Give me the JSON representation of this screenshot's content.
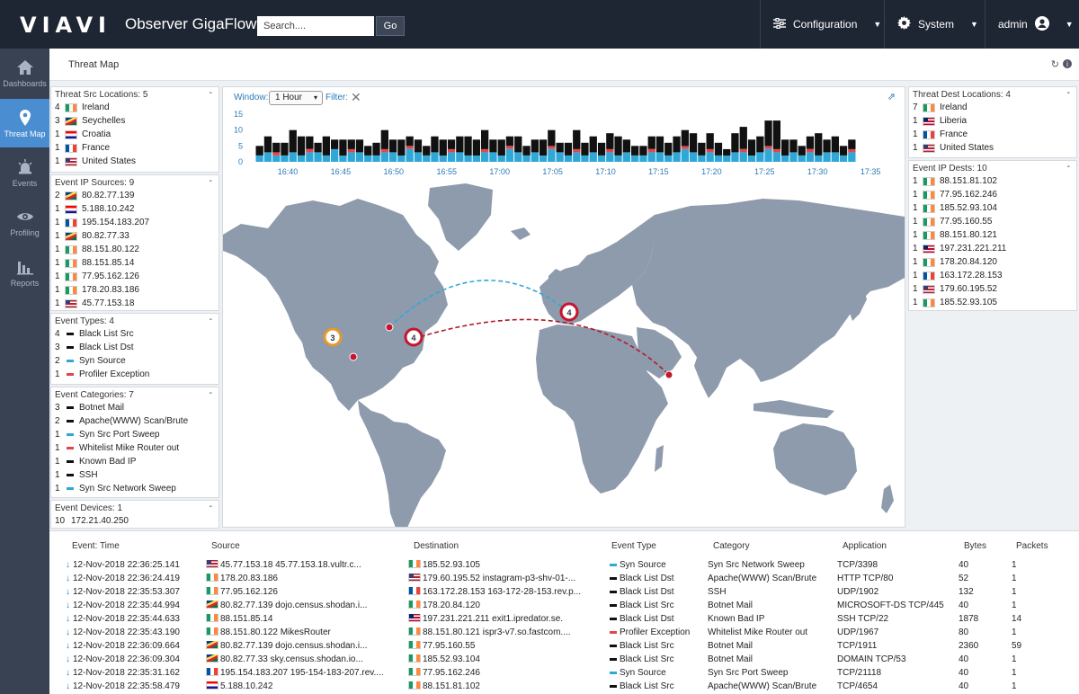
{
  "header": {
    "logo": "VIAVI",
    "app_title": "Observer GigaFlow",
    "search_placeholder": "Search....",
    "go_label": "Go",
    "config_label": "Configuration",
    "system_label": "System",
    "user_label": "admin"
  },
  "sidebar": {
    "items": [
      {
        "label": "Dashboards",
        "icon": "home-icon"
      },
      {
        "label": "Threat Map",
        "icon": "map-pin-icon"
      },
      {
        "label": "Events",
        "icon": "alarm-icon"
      },
      {
        "label": "Profiling",
        "icon": "eye-icon"
      },
      {
        "label": "Reports",
        "icon": "bar-chart-icon"
      }
    ]
  },
  "page": {
    "title": "Threat Map"
  },
  "panels": {
    "src_locations": {
      "title": "Threat Src Locations: 5",
      "rows": [
        {
          "count": "4",
          "label": "Ireland",
          "flag": "ie"
        },
        {
          "count": "3",
          "label": "Seychelles",
          "flag": "sc"
        },
        {
          "count": "1",
          "label": "Croatia",
          "flag": "hr"
        },
        {
          "count": "1",
          "label": "France",
          "flag": "fr"
        },
        {
          "count": "1",
          "label": "United States",
          "flag": "us"
        }
      ]
    },
    "ip_sources": {
      "title": "Event IP Sources: 9",
      "rows": [
        {
          "count": "2",
          "label": "80.82.77.139",
          "flag": "sc"
        },
        {
          "count": "1",
          "label": "5.188.10.242",
          "flag": "hr"
        },
        {
          "count": "1",
          "label": "195.154.183.207",
          "flag": "fr"
        },
        {
          "count": "1",
          "label": "80.82.77.33",
          "flag": "sc"
        },
        {
          "count": "1",
          "label": "88.151.80.122",
          "flag": "ie"
        },
        {
          "count": "1",
          "label": "88.151.85.14",
          "flag": "ie"
        },
        {
          "count": "1",
          "label": "77.95.162.126",
          "flag": "ie"
        },
        {
          "count": "1",
          "label": "178.20.83.186",
          "flag": "ie"
        },
        {
          "count": "1",
          "label": "45.77.153.18",
          "flag": "us"
        }
      ]
    },
    "event_types": {
      "title": "Event Types: 4",
      "rows": [
        {
          "count": "4",
          "label": "Black List Src",
          "color": "#111111"
        },
        {
          "count": "3",
          "label": "Black List Dst",
          "color": "#111111"
        },
        {
          "count": "2",
          "label": "Syn Source",
          "color": "#2fa8d8"
        },
        {
          "count": "1",
          "label": "Profiler Exception",
          "color": "#e0474c"
        }
      ]
    },
    "event_categories": {
      "title": "Event Categories: 7",
      "rows": [
        {
          "count": "3",
          "label": "Botnet Mail",
          "color": "#111111"
        },
        {
          "count": "2",
          "label": "Apache(WWW) Scan/Brute",
          "color": "#111111"
        },
        {
          "count": "1",
          "label": "Syn Src Port Sweep",
          "color": "#2fa8d8"
        },
        {
          "count": "1",
          "label": "Whitelist Mike Router out",
          "color": "#e0474c"
        },
        {
          "count": "1",
          "label": "Known Bad IP",
          "color": "#111111"
        },
        {
          "count": "1",
          "label": "SSH",
          "color": "#111111"
        },
        {
          "count": "1",
          "label": "Syn Src Network Sweep",
          "color": "#2fa8d8"
        }
      ]
    },
    "event_devices": {
      "title": "Event Devices: 1",
      "rows": [
        {
          "count": "10",
          "label": "172.21.40.250"
        }
      ]
    },
    "dest_locations": {
      "title": "Threat Dest Locations: 4",
      "rows": [
        {
          "count": "7",
          "label": "Ireland",
          "flag": "ie"
        },
        {
          "count": "1",
          "label": "Liberia",
          "flag": "lr"
        },
        {
          "count": "1",
          "label": "France",
          "flag": "fr"
        },
        {
          "count": "1",
          "label": "United States",
          "flag": "us"
        }
      ]
    },
    "ip_dests": {
      "title": "Event IP Dests: 10",
      "rows": [
        {
          "count": "1",
          "label": "88.151.81.102",
          "flag": "ie"
        },
        {
          "count": "1",
          "label": "77.95.162.246",
          "flag": "ie"
        },
        {
          "count": "1",
          "label": "185.52.93.104",
          "flag": "ie"
        },
        {
          "count": "1",
          "label": "77.95.160.55",
          "flag": "ie"
        },
        {
          "count": "1",
          "label": "88.151.80.121",
          "flag": "ie"
        },
        {
          "count": "1",
          "label": "197.231.221.211",
          "flag": "lr"
        },
        {
          "count": "1",
          "label": "178.20.84.120",
          "flag": "ie"
        },
        {
          "count": "1",
          "label": "163.172.28.153",
          "flag": "fr"
        },
        {
          "count": "1",
          "label": "179.60.195.52",
          "flag": "us"
        },
        {
          "count": "1",
          "label": "185.52.93.105",
          "flag": "ie"
        }
      ]
    }
  },
  "map": {
    "window_label": "Window:",
    "window_value": "1 Hour",
    "filter_label": "Filter:",
    "markers": [
      {
        "label": "3",
        "color": "#e59a2a"
      },
      {
        "label": "4",
        "color": "#c4172e"
      },
      {
        "label": "4",
        "color": "#c4172e"
      }
    ]
  },
  "chart_data": {
    "type": "bar",
    "stacked": true,
    "y_ticks": [
      "15",
      "10",
      "5",
      "0"
    ],
    "ylim": [
      0,
      15
    ],
    "x_ticks": [
      "16:40",
      "16:45",
      "16:50",
      "16:55",
      "17:00",
      "17:05",
      "17:10",
      "17:15",
      "17:20",
      "17:25",
      "17:30",
      "17:35"
    ],
    "series": [
      {
        "color": "#2fa8d8",
        "values": [
          2,
          3,
          2,
          2,
          3,
          2,
          3,
          3,
          2,
          4,
          2,
          3,
          3,
          2,
          2,
          3,
          3,
          2,
          4,
          3,
          2,
          3,
          2,
          3,
          3,
          2,
          2,
          3,
          3,
          2,
          4,
          3,
          2,
          3,
          2,
          4,
          3,
          2,
          3,
          2,
          3,
          2,
          3,
          2,
          3,
          2,
          2,
          3,
          3,
          2,
          3,
          4,
          3,
          2,
          3,
          2,
          2,
          3,
          3,
          2,
          3,
          4,
          3,
          2,
          3,
          2,
          3,
          2,
          3,
          3,
          2,
          3
        ]
      },
      {
        "color": "#e0474c",
        "values": [
          0,
          0,
          1,
          0,
          0,
          0,
          1,
          0,
          0,
          0,
          0,
          1,
          0,
          0,
          0,
          1,
          0,
          0,
          1,
          0,
          0,
          0,
          0,
          1,
          0,
          0,
          0,
          1,
          0,
          0,
          1,
          0,
          0,
          0,
          0,
          1,
          0,
          0,
          1,
          0,
          0,
          0,
          1,
          0,
          0,
          0,
          0,
          1,
          0,
          0,
          0,
          1,
          0,
          0,
          1,
          0,
          0,
          0,
          1,
          0,
          0,
          1,
          1,
          0,
          0,
          0,
          1,
          0,
          0,
          0,
          0,
          1
        ]
      },
      {
        "color": "#111111",
        "values": [
          3,
          5,
          3,
          4,
          7,
          6,
          4,
          3,
          6,
          3,
          5,
          3,
          4,
          3,
          4,
          6,
          4,
          5,
          3,
          4,
          3,
          5,
          5,
          3,
          5,
          6,
          5,
          6,
          4,
          5,
          3,
          5,
          3,
          4,
          5,
          5,
          3,
          4,
          6,
          4,
          5,
          4,
          5,
          6,
          4,
          3,
          3,
          4,
          5,
          4,
          5,
          5,
          6,
          4,
          5,
          4,
          2,
          6,
          7,
          5,
          5,
          8,
          9,
          5,
          4,
          3,
          4,
          7,
          4,
          5,
          3,
          3
        ]
      }
    ]
  },
  "table": {
    "headers": [
      "Event: Time",
      "Source",
      "Destination",
      "Event Type",
      "Category",
      "Application",
      "Bytes",
      "Packets"
    ],
    "rows": [
      {
        "time": "12-Nov-2018 22:36:25.141",
        "src_flag": "us",
        "source": "45.77.153.18 45.77.153.18.vultr.c...",
        "dst_flag": "ie",
        "dest": "185.52.93.105",
        "type_color": "#2fa8d8",
        "type": "Syn Source",
        "category": "Syn Src Network Sweep",
        "app": "TCP/3398",
        "bytes": "40",
        "packets": "1"
      },
      {
        "time": "12-Nov-2018 22:36:24.419",
        "src_flag": "ie",
        "source": "178.20.83.186",
        "dst_flag": "us",
        "dest": "179.60.195.52 instagram-p3-shv-01-...",
        "type_color": "#111111",
        "type": "Black List Dst",
        "category": "Apache(WWW) Scan/Brute",
        "app": "HTTP TCP/80",
        "bytes": "52",
        "packets": "1"
      },
      {
        "time": "12-Nov-2018 22:35:53.307",
        "src_flag": "ie",
        "source": "77.95.162.126",
        "dst_flag": "fr",
        "dest": "163.172.28.153 163-172-28-153.rev.p...",
        "type_color": "#111111",
        "type": "Black List Dst",
        "category": "SSH",
        "app": "UDP/1902",
        "bytes": "132",
        "packets": "1"
      },
      {
        "time": "12-Nov-2018 22:35:44.994",
        "src_flag": "sc",
        "source": "80.82.77.139 dojo.census.shodan.i...",
        "dst_flag": "ie",
        "dest": "178.20.84.120",
        "type_color": "#111111",
        "type": "Black List Src",
        "category": "Botnet Mail",
        "app": "MICROSOFT-DS TCP/445",
        "bytes": "40",
        "packets": "1"
      },
      {
        "time": "12-Nov-2018 22:35:44.633",
        "src_flag": "ie",
        "source": "88.151.85.14",
        "dst_flag": "lr",
        "dest": "197.231.221.211 exit1.ipredator.se.",
        "type_color": "#111111",
        "type": "Black List Dst",
        "category": "Known Bad IP",
        "app": "SSH TCP/22",
        "bytes": "1878",
        "packets": "14"
      },
      {
        "time": "12-Nov-2018 22:35:43.190",
        "src_flag": "ie",
        "source": "88.151.80.122 MikesRouter",
        "dst_flag": "ie",
        "dest": "88.151.80.121 ispr3-v7.so.fastcom....",
        "type_color": "#e0474c",
        "type": "Profiler Exception",
        "category": "Whitelist Mike Router out",
        "app": "UDP/1967",
        "bytes": "80",
        "packets": "1"
      },
      {
        "time": "12-Nov-2018 22:36:09.664",
        "src_flag": "sc",
        "source": "80.82.77.139 dojo.census.shodan.i...",
        "dst_flag": "ie",
        "dest": "77.95.160.55",
        "type_color": "#111111",
        "type": "Black List Src",
        "category": "Botnet Mail",
        "app": "TCP/1911",
        "bytes": "2360",
        "packets": "59"
      },
      {
        "time": "12-Nov-2018 22:36:09.304",
        "src_flag": "sc",
        "source": "80.82.77.33 sky.census.shodan.io...",
        "dst_flag": "ie",
        "dest": "185.52.93.104",
        "type_color": "#111111",
        "type": "Black List Src",
        "category": "Botnet Mail",
        "app": "DOMAIN TCP/53",
        "bytes": "40",
        "packets": "1"
      },
      {
        "time": "12-Nov-2018 22:35:31.162",
        "src_flag": "fr",
        "source": "195.154.183.207 195-154-183-207.rev....",
        "dst_flag": "ie",
        "dest": "77.95.162.246",
        "type_color": "#2fa8d8",
        "type": "Syn Source",
        "category": "Syn Src Port Sweep",
        "app": "TCP/21118",
        "bytes": "40",
        "packets": "1"
      },
      {
        "time": "12-Nov-2018 22:35:58.479",
        "src_flag": "hr",
        "source": "5.188.10.242",
        "dst_flag": "ie",
        "dest": "88.151.81.102",
        "type_color": "#111111",
        "type": "Black List Src",
        "category": "Apache(WWW) Scan/Brute",
        "app": "TCP/4654",
        "bytes": "40",
        "packets": "1"
      }
    ]
  },
  "flags": {
    "ie": [
      "#169b62",
      "#ffffff",
      "#ff883e"
    ],
    "fr": [
      "#0055a4",
      "#ffffff",
      "#ef4135"
    ],
    "hr": [
      "#ff0000",
      "#ffffff",
      "#171796"
    ],
    "sc": [
      "#003f87",
      "#fcd856",
      "#d62828",
      "#007a3d"
    ],
    "us": [
      "#b22234",
      "#ffffff",
      "#3c3b6e"
    ],
    "lr": [
      "#bf0a30",
      "#ffffff",
      "#002868"
    ]
  }
}
